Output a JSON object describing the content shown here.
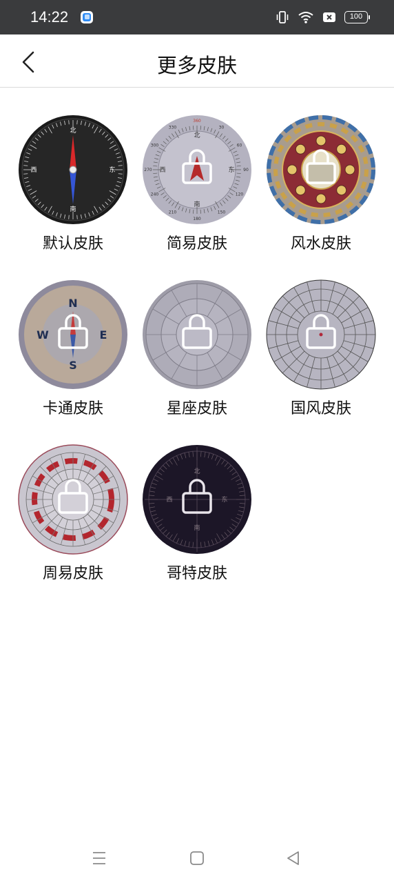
{
  "status_bar": {
    "time": "14:22",
    "battery": "100",
    "icons": [
      "app-icon",
      "vibrate-icon",
      "wifi-icon",
      "sim-x-icon",
      "battery-icon"
    ]
  },
  "header": {
    "title": "更多皮肤",
    "back_icon": "chevron-left-icon"
  },
  "skins": [
    {
      "label": "默认皮肤",
      "locked": false,
      "style": "black-classic"
    },
    {
      "label": "简易皮肤",
      "locked": true,
      "style": "gray-degree"
    },
    {
      "label": "风水皮肤",
      "locked": true,
      "style": "fengshui-red"
    },
    {
      "label": "卡通皮肤",
      "locked": true,
      "style": "cartoon-beige"
    },
    {
      "label": "星座皮肤",
      "locked": true,
      "style": "zodiac-gray"
    },
    {
      "label": "国风皮肤",
      "locked": true,
      "style": "chinese-trigram"
    },
    {
      "label": "周易皮肤",
      "locked": true,
      "style": "zhouyi-red"
    },
    {
      "label": "哥特皮肤",
      "locked": true,
      "style": "gothic-dark"
    }
  ],
  "dial_text": {
    "default": [
      "北",
      "南",
      "东",
      "西"
    ],
    "simple": [
      "360",
      "30",
      "60",
      "90",
      "120",
      "150",
      "180",
      "210",
      "240",
      "270",
      "300",
      "330",
      "北",
      "南",
      "东",
      "西"
    ],
    "cartoon": [
      "N",
      "S",
      "E",
      "W"
    ],
    "gothic": [
      "北",
      "南",
      "东",
      "西"
    ]
  },
  "nav_bar": {
    "icons": [
      "menu-icon",
      "home-icon",
      "back-triangle-icon"
    ]
  },
  "colors": {
    "status_bar_bg": "#3a3b3d",
    "lock_stroke": "#ffffff",
    "overlay": "rgba(40,40,40,0.35)",
    "text": "#111111"
  }
}
